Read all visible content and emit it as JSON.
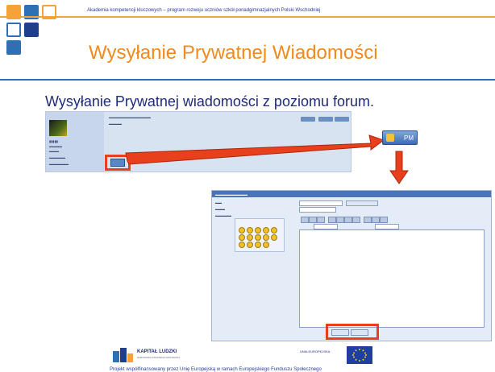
{
  "header": {
    "program_text": "Akademia kompetencji kluczowych – program rozwoju uczniów szkół ponadgimnazjalnych Polski Wschodniej"
  },
  "slide": {
    "title": "Wysyłanie Prywatnej Wiadomości",
    "subtitle": "Wysyłanie Prywatnej wiadomości z poziomu forum."
  },
  "pm_button": {
    "label": "PM"
  },
  "footer": {
    "kapital_ludzki": "KAPITAŁ LUDZKI",
    "kapital_ludzki_sub": "NARODOWA STRATEGIA SPÓJNOŚCI",
    "eu_label": "UNIA EUROPEJSKA",
    "cofinance_text": "Projekt współfinansowany przez Unię Europejską w ramach Europejskiego Funduszu Społecznego"
  },
  "colors": {
    "orange": "#f3a33a",
    "blue": "#2f6fb3",
    "navy": "#1e2a7a",
    "highlight": "#e8401c"
  },
  "icons": {
    "pm": "pm-icon",
    "smilies": "smiley-icon"
  }
}
